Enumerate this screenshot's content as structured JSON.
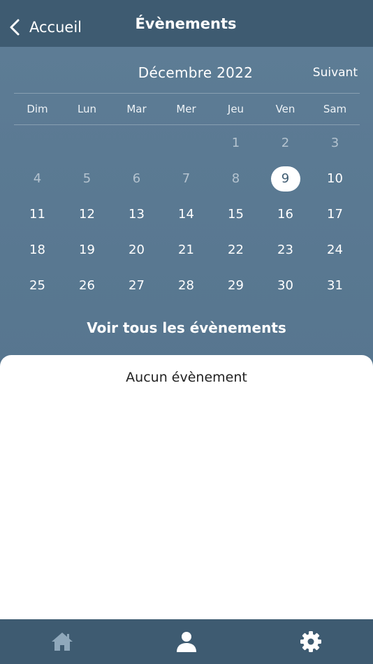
{
  "colors": {
    "header": "#3e5b71",
    "calendar": "#5b7a93",
    "accent": "#ffffff",
    "muted_day": "#b4c3cf",
    "inactive_tab": "#8fa8bb"
  },
  "nav": {
    "back_label": "Accueil",
    "title": "Évènements",
    "back_icon": "chevron-left-icon"
  },
  "calendar": {
    "month": "Décembre 2022",
    "next_label": "Suivant",
    "weekdays": [
      "Dim",
      "Lun",
      "Mar",
      "Mer",
      "Jeu",
      "Ven",
      "Sam"
    ],
    "leading_blank_days": 4,
    "days_in_month": 31,
    "past_until_day": 8,
    "selected_day": 9,
    "see_all_label": "Voir tous les évènements"
  },
  "events": {
    "empty_message": "Aucun évènement"
  },
  "tabbar": {
    "items": [
      {
        "icon": "home-icon",
        "active": false
      },
      {
        "icon": "user-icon",
        "active": true
      },
      {
        "icon": "gear-icon",
        "active": true
      }
    ]
  }
}
